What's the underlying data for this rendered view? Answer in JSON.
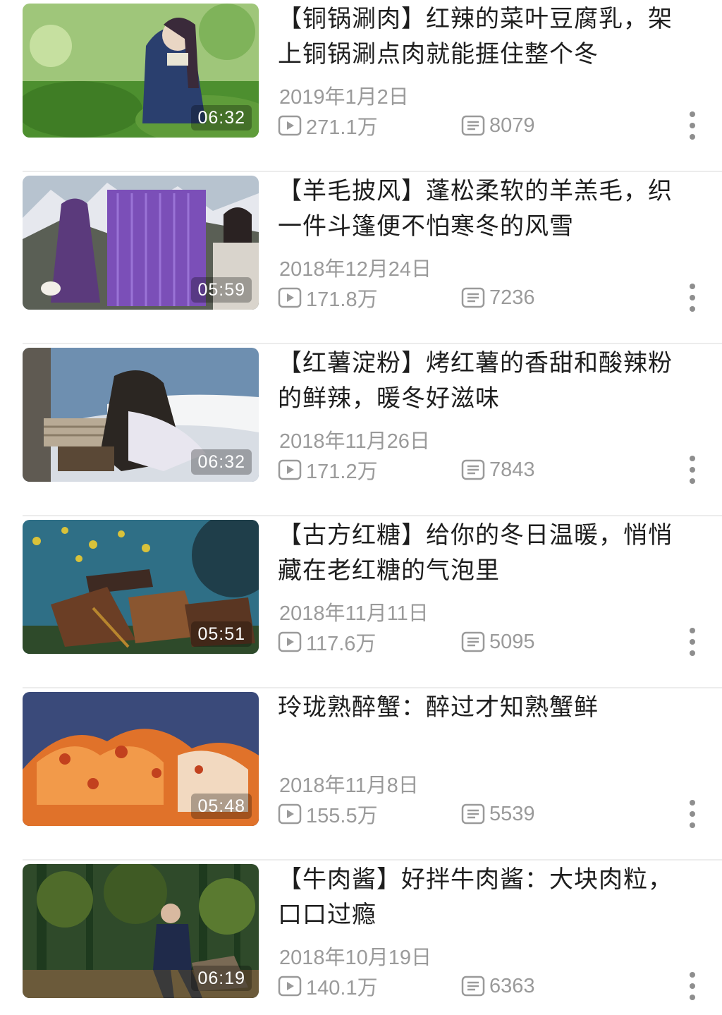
{
  "videos": [
    {
      "title": "【铜锅涮肉】红辣的菜叶豆腐乳，架上铜锅涮点肉就能捱住整个冬",
      "duration": "06:32",
      "date": "2019年1月2日",
      "views": "271.1万",
      "comments": "8079",
      "thumb_palette": {
        "sky": "#9fc67a",
        "ground": "#4d8f2f",
        "accent": "#2a3f6e",
        "highlight": "#e9e5d4"
      }
    },
    {
      "title": "【羊毛披风】蓬松柔软的羊羔毛，织一件斗篷便不怕寒冬的风雪",
      "duration": "05:59",
      "date": "2018年12月24日",
      "views": "171.8万",
      "comments": "7236",
      "thumb_palette": {
        "sky": "#b7c3cf",
        "ground": "#5a5f55",
        "accent": "#7b4fb8",
        "highlight": "#e6e8ee"
      }
    },
    {
      "title": "【红薯淀粉】烤红薯的香甜和酸辣粉的鲜辣，暖冬好滋味",
      "duration": "06:32",
      "date": "2018年11月26日",
      "views": "171.2万",
      "comments": "7843",
      "thumb_palette": {
        "sky": "#6e8fb0",
        "ground": "#d8dde4",
        "accent": "#2b2622",
        "highlight": "#f4f5f6"
      }
    },
    {
      "title": "【古方红糖】给你的冬日温暖，悄悄藏在老红糖的气泡里",
      "duration": "05:51",
      "date": "2018年11月11日",
      "views": "117.6万",
      "comments": "5095",
      "thumb_palette": {
        "sky": "#2f6f86",
        "ground": "#3e2a22",
        "accent": "#b8862e",
        "highlight": "#d9c23a"
      }
    },
    {
      "title": "玲珑熟醉蟹：醉过才知熟蟹鲜",
      "duration": "05:48",
      "date": "2018年11月8日",
      "views": "155.5万",
      "comments": "5539",
      "thumb_palette": {
        "sky": "#3a4a7a",
        "ground": "#6a2a2a",
        "accent": "#e0722a",
        "highlight": "#f2d9c0"
      }
    },
    {
      "title": "【牛肉酱】好拌牛肉酱：大块肉粒，口口过瘾",
      "duration": "06:19",
      "date": "2018年10月19日",
      "views": "140.1万",
      "comments": "6363",
      "thumb_palette": {
        "sky": "#2f4a2a",
        "ground": "#4f6b2a",
        "accent": "#1f2a4a",
        "highlight": "#9fb070"
      }
    }
  ],
  "icons": {
    "views": "play-icon",
    "comments": "danmaku-icon",
    "more": "more-vertical-icon"
  },
  "colors": {
    "meta_text": "#9a9a9a",
    "title_text": "#1e1e1e",
    "divider": "#ececec"
  }
}
